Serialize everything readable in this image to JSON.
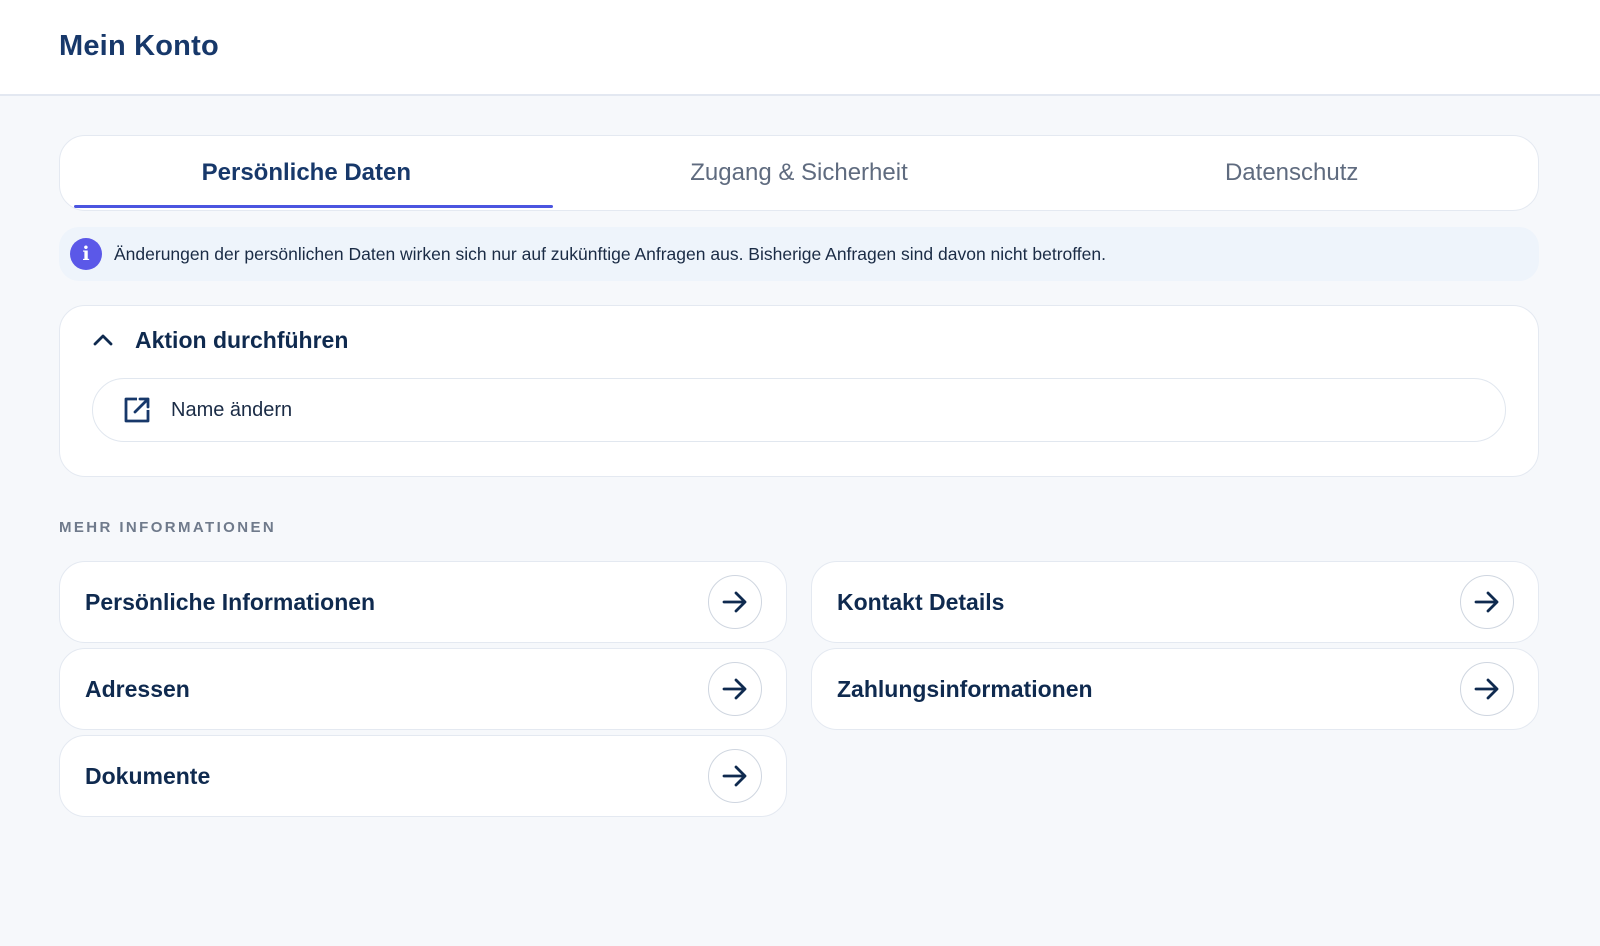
{
  "header": {
    "title": "Mein Konto"
  },
  "tabs": [
    {
      "label": "Persönliche Daten",
      "active": true
    },
    {
      "label": "Zugang & Sicherheit",
      "active": false
    },
    {
      "label": "Datenschutz",
      "active": false
    }
  ],
  "info": {
    "icon": "info-icon",
    "text": "Änderungen der persönlichen Daten wirken sich nur auf zukünftige Anfragen aus. Bisherige Anfragen sind davon nicht betroffen."
  },
  "action": {
    "title": "Aktion durchführen",
    "expanded": true,
    "items": [
      {
        "label": "Name ändern",
        "icon": "external-link-icon"
      }
    ]
  },
  "more": {
    "section_label": "MEHR INFORMATIONEN",
    "links": [
      {
        "label": "Persönliche Informationen"
      },
      {
        "label": "Kontakt Details"
      },
      {
        "label": "Adressen"
      },
      {
        "label": "Zahlungsinformationen"
      },
      {
        "label": "Dokumente"
      }
    ]
  },
  "colors": {
    "accent": "#4b55e0",
    "info_icon": "#5b58e8",
    "text_dark": "#0f2a4f"
  }
}
